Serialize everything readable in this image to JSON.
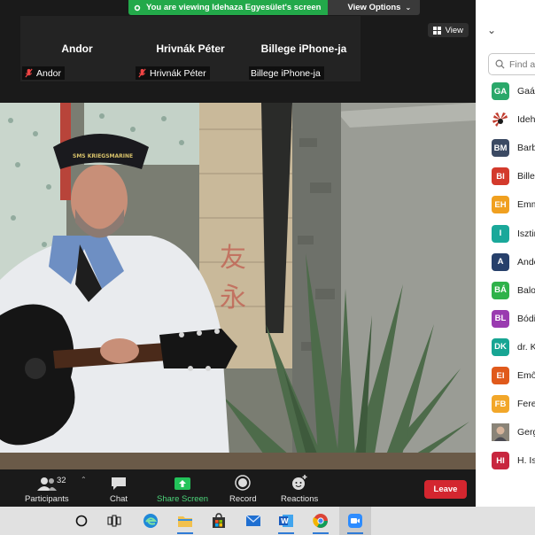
{
  "banner": {
    "message": "You are viewing Idehaza Egyesület's screen",
    "view_options": "View Options"
  },
  "gallery": {
    "view_label": "View",
    "tiles": [
      {
        "name": "Andor",
        "label": "Andor",
        "muted": true
      },
      {
        "name": "Hrivnák Péter",
        "label": "Hrivnák Péter",
        "muted": true
      },
      {
        "name": "Billege iPhone-ja",
        "label": "Billege iPhone-ja",
        "muted": false
      }
    ]
  },
  "video": {
    "cap_text": "SMS KRIEGSMARINE"
  },
  "toolbar": {
    "participants_label": "Participants",
    "participants_count": "32",
    "chat_label": "Chat",
    "share_label": "Share Screen",
    "record_label": "Record",
    "reactions_label": "Reactions",
    "leave_label": "Leave"
  },
  "panel": {
    "search_placeholder": "Find a",
    "participants": [
      {
        "initials": "GA",
        "name": "Gaál",
        "color": "#2aa86a"
      },
      {
        "initials": "",
        "name": "Ideh",
        "color": "#ffffff",
        "logo": true
      },
      {
        "initials": "BM",
        "name": "Barb",
        "color": "#3b4a63"
      },
      {
        "initials": "BI",
        "name": "Bille",
        "color": "#d33a2c"
      },
      {
        "initials": "EH",
        "name": "Emm",
        "color": "#f0a020"
      },
      {
        "initials": "I",
        "name": "Isztin",
        "color": "#1aa89a"
      },
      {
        "initials": "A",
        "name": "Andc",
        "color": "#27406b"
      },
      {
        "initials": "BÁ",
        "name": "Balo",
        "color": "#2fb24a"
      },
      {
        "initials": "BL",
        "name": "Bódi",
        "color": "#9a3bb0"
      },
      {
        "initials": "DK",
        "name": "dr. K",
        "color": "#17a593"
      },
      {
        "initials": "EI",
        "name": "Emő",
        "color": "#e05a1c"
      },
      {
        "initials": "FB",
        "name": "Fere",
        "color": "#f2a72a"
      },
      {
        "initials": "",
        "name": "Gerg",
        "color": "#8a8478",
        "photo": true
      },
      {
        "initials": "HI",
        "name": "H. Is",
        "color": "#c8263e"
      }
    ]
  },
  "taskbar": {
    "apps": [
      "cortana-icon",
      "task-view-icon",
      "edge-icon",
      "file-explorer-icon",
      "store-icon",
      "mail-icon",
      "word-icon",
      "chrome-icon",
      "zoom-icon"
    ]
  }
}
